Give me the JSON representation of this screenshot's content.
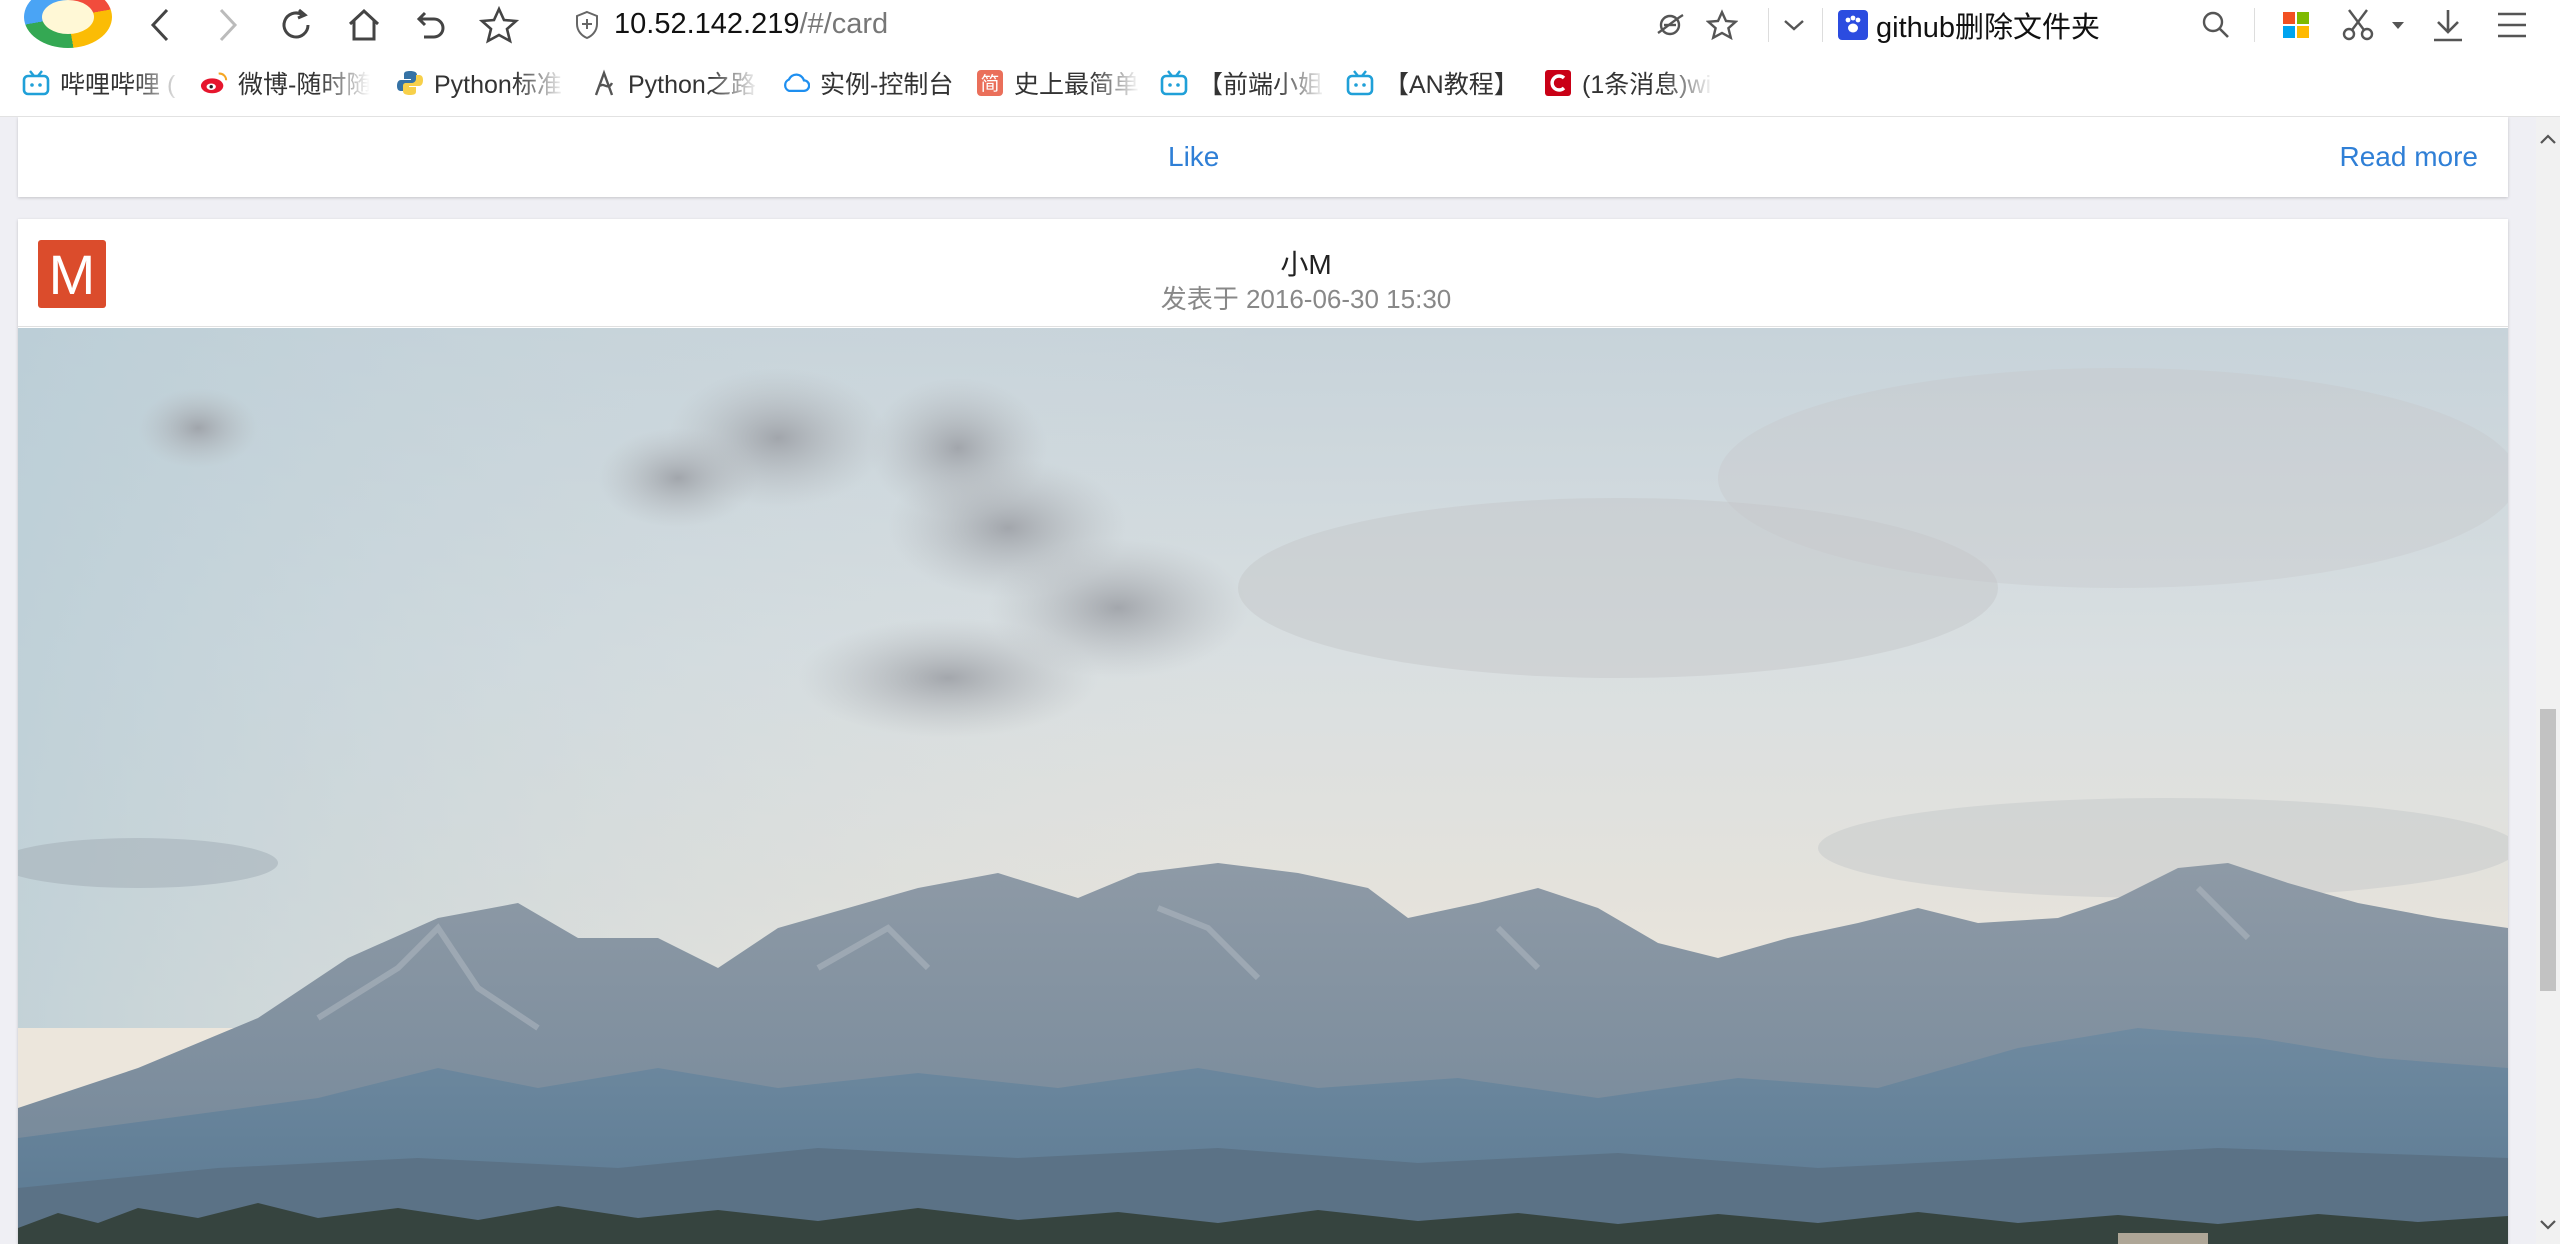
{
  "browser": {
    "url_host": "10.52.142.219",
    "url_path": "/#/card",
    "search_text": "github删除文件夹",
    "icons": [
      "back-icon",
      "forward-icon",
      "reload-icon",
      "home-icon",
      "undo-icon",
      "star-icon",
      "shield-icon",
      "ie-compat-icon",
      "bookmark-star-icon",
      "dropdown-icon",
      "paw-icon",
      "search-icon",
      "apps-icon",
      "scissors-icon",
      "download-icon",
      "menu-icon"
    ]
  },
  "bookmarks": [
    {
      "label": "哔哩哔哩 (",
      "icon": "bilibili-icon",
      "color": "#20a0d8"
    },
    {
      "label": "微博-随时随",
      "icon": "weibo-icon",
      "color": "#e6162d"
    },
    {
      "label": "Python标准",
      "icon": "python-icon",
      "color": "#3572a5"
    },
    {
      "label": "Python之路",
      "icon": "pen-icon",
      "color": "#555555"
    },
    {
      "label": "实例-控制台",
      "icon": "cloud-icon",
      "color": "#1e8ff0"
    },
    {
      "label": "史上最简单",
      "icon": "jian-icon",
      "color": "#ea6f5a"
    },
    {
      "label": "【前端小姐",
      "icon": "bilibili-icon",
      "color": "#20a0d8"
    },
    {
      "label": "【AN教程】",
      "icon": "bilibili-icon",
      "color": "#20a0d8"
    },
    {
      "label": "(1条消息)wi",
      "icon": "csdn-icon",
      "color": "#c90016"
    }
  ],
  "prev_card": {
    "like_label": "Like",
    "read_more_label": "Read more"
  },
  "card": {
    "avatar_letter": "M",
    "author": "小M",
    "date": "发表于 2016-06-30 15:30",
    "image": "mountain-landscape"
  },
  "colors": {
    "link": "#2f7fd6",
    "avatar": "#db4c2c",
    "page_bg": "#efeff4"
  }
}
